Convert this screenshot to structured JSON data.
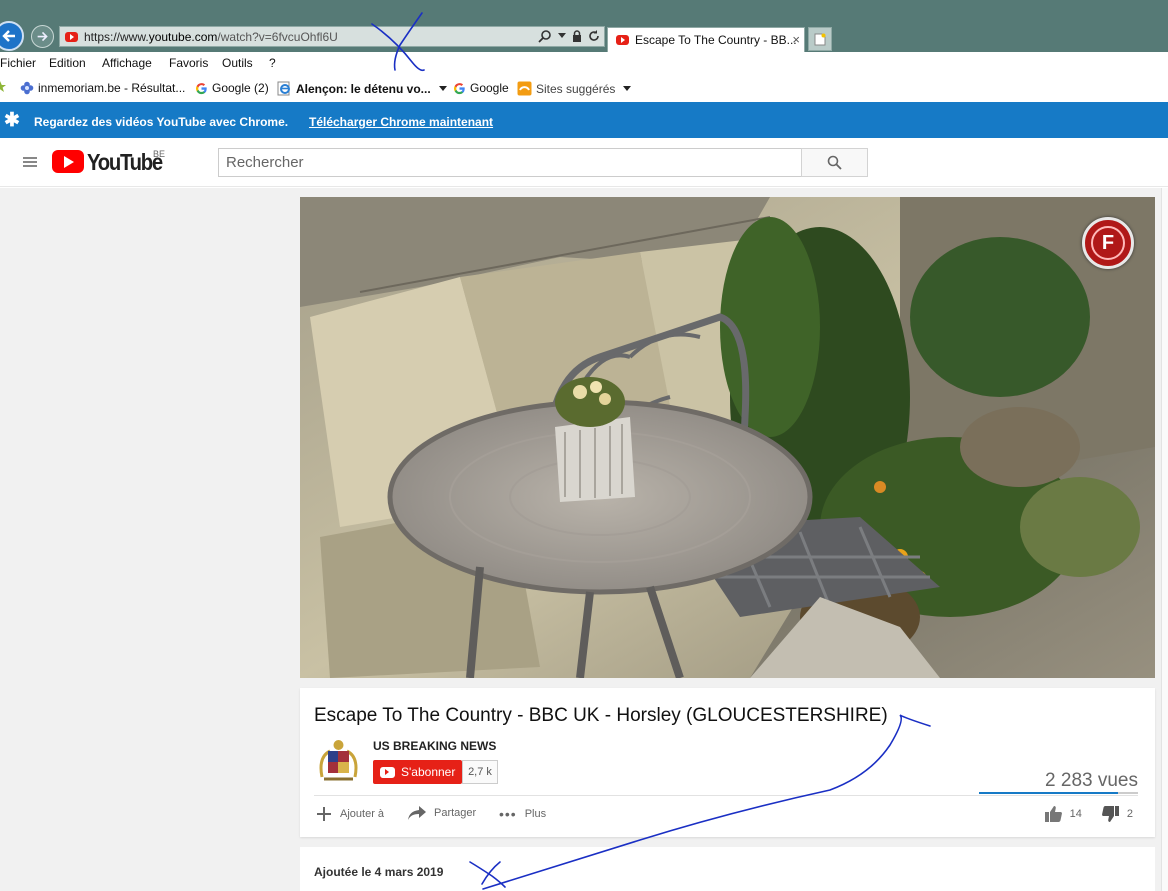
{
  "browser": {
    "url_prefix": "https://www.",
    "url_domain": "youtube.com",
    "url_path": "/watch?v=6fvcuOhfl6U",
    "tab_title": "Escape To The Country - BB...",
    "tab_close": "×",
    "menu": [
      "Fichier",
      "Edition",
      "Affichage",
      "Favoris",
      "Outils",
      "?"
    ],
    "favorites": [
      {
        "label": "inmemoriam.be - Résultat...",
        "icon": "flower-icon"
      },
      {
        "label": "Google (2)",
        "icon": "google-icon"
      },
      {
        "label": "Alençon: le détenu vo...",
        "icon": "ie-page-icon"
      },
      {
        "label": "Google",
        "icon": "google-icon"
      },
      {
        "label": "Sites suggérés",
        "icon": "suggested-sites-icon"
      }
    ]
  },
  "banner": {
    "text": "Regardez des vidéos YouTube avec Chrome.",
    "link": "Télécharger Chrome maintenant"
  },
  "header": {
    "logo_text": "YouTube",
    "country": "BE",
    "search_placeholder": "Rechercher"
  },
  "video": {
    "title": "Escape To The Country - BBC UK - Horsley (GLOUCESTERSHIRE)",
    "channel": "US BREAKING NEWS",
    "subscribe_label": "S'abonner",
    "subscriber_count": "2,7 k",
    "views": "2 283 vues",
    "like_ratio": 0.875,
    "actions": {
      "add_to": "Ajouter à",
      "share": "Partager",
      "more": "Plus"
    },
    "likes": "14",
    "dislikes": "2",
    "watermark_letter": "F",
    "upload_date": "Ajoutée le 4 mars 2019"
  },
  "colors": {
    "titlebar": "#567a76",
    "banner": "#167ac6",
    "youtube_red": "#e62117",
    "annotation_ink": "#1a2fc4"
  }
}
